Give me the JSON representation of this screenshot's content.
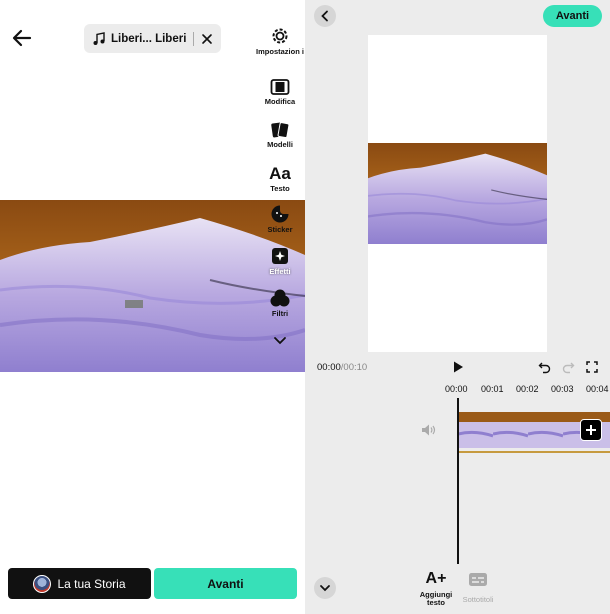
{
  "left_panel": {
    "music": {
      "title": "Liberi... Liberi-...",
      "icon": "music-note-icon"
    },
    "tools": [
      {
        "label": "Impostazion i",
        "icon": "gear-icon"
      },
      {
        "label": "Modifica",
        "icon": "edit-clip-icon"
      },
      {
        "label": "Modelli",
        "icon": "templates-icon"
      },
      {
        "label": "Testo",
        "icon": "text-aa-icon"
      },
      {
        "label": "Sticker",
        "icon": "sticker-icon"
      },
      {
        "label": "Effetti",
        "icon": "effects-icon"
      },
      {
        "label": "Filtri",
        "icon": "filters-icon"
      }
    ],
    "story_button": "La tua Storia",
    "next_button": "Avanti"
  },
  "right_panel": {
    "next_button": "Avanti",
    "time_current": "00:00",
    "time_separator": "/",
    "time_total": "00:10",
    "ruler_ticks": [
      "00:00",
      "00:01",
      "00:02",
      "00:03",
      "00:04"
    ],
    "add_text_glyph": "A+",
    "add_text_label": "Aggiungi testo",
    "subtitles_label": "Sottotitoli"
  },
  "colors": {
    "accent": "#37e0b8",
    "timeline_line": "#c69a3f"
  }
}
